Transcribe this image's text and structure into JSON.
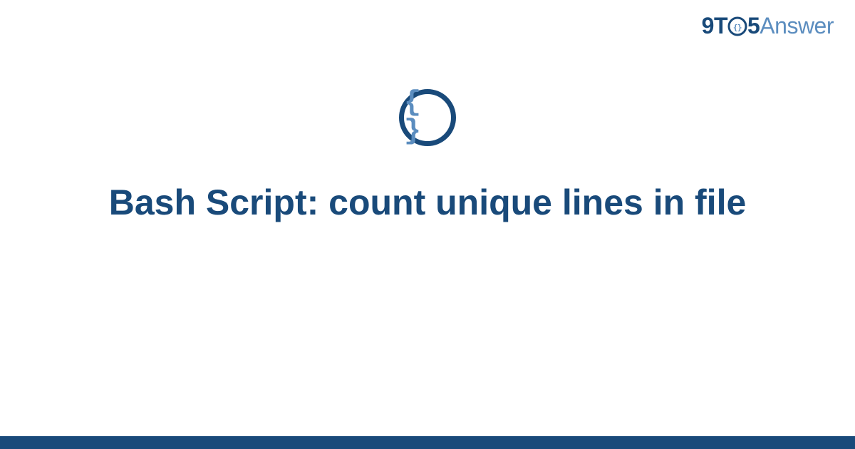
{
  "logo": {
    "part1": "9T",
    "part2": "5",
    "part3": "Answer"
  },
  "category": {
    "icon_name": "code-braces-icon",
    "symbol": "{ }"
  },
  "title": "Bash Script: count unique lines in file",
  "colors": {
    "primary": "#194a7a",
    "secondary": "#5b8dbf"
  }
}
